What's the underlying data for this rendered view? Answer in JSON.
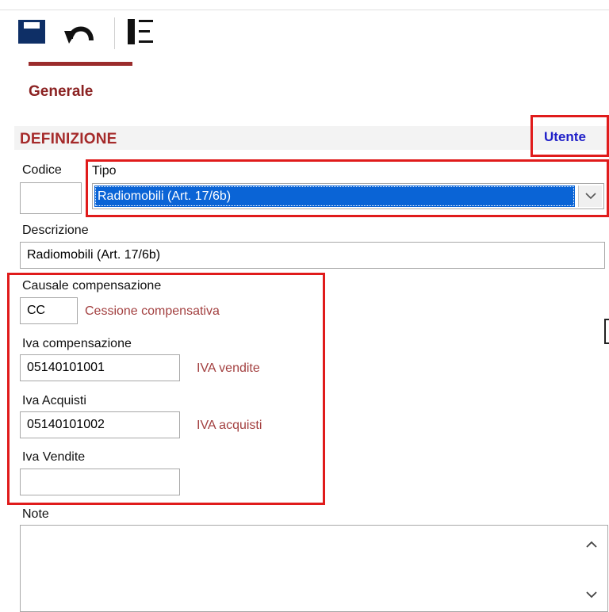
{
  "toolbar": {
    "save_icon": "save-icon",
    "undo_icon": "undo-icon",
    "list_icon": "list-icon"
  },
  "tabs": [
    {
      "label": "Generale",
      "active": true
    }
  ],
  "section": {
    "title": "DEFINIZIONE",
    "user_link": "Utente"
  },
  "fields": {
    "codice": {
      "label": "Codice",
      "value": ""
    },
    "tipo": {
      "label": "Tipo",
      "value": "Radiomobili (Art. 17/6b)"
    },
    "descrizione": {
      "label": "Descrizione",
      "value": "Radiomobili (Art. 17/6b)"
    },
    "causale": {
      "label": "Causale compensazione",
      "value": "CC",
      "description": "Cessione compensativa"
    },
    "iva_comp": {
      "label": "Iva compensazione",
      "value": "05140101001",
      "description": "IVA vendite"
    },
    "iva_acq": {
      "label": "Iva Acquisti",
      "value": "05140101002",
      "description": "IVA acquisti"
    },
    "iva_vend": {
      "label": "Iva Vendite",
      "value": ""
    },
    "note": {
      "label": "Note",
      "value": ""
    }
  },
  "colors": {
    "accent": "#9b2c2c",
    "section_title": "#a52a2a",
    "link": "#1f1fc8",
    "highlight_box": "#e01b1b",
    "selection": "#0a64d6",
    "description": "#a34040"
  }
}
